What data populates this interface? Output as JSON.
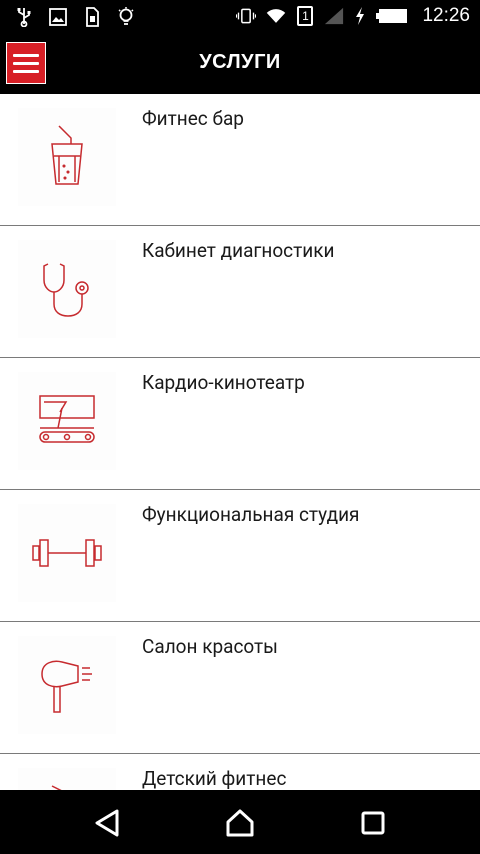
{
  "status_bar": {
    "time": "12:26",
    "sim_badge": "1",
    "icons": [
      "usb-icon",
      "image-icon",
      "sim-icon",
      "lightbulb-icon",
      "vibrate-icon",
      "wifi-icon",
      "signal-icon",
      "charging-icon",
      "battery-icon"
    ]
  },
  "app_bar": {
    "title": "УСЛУГИ",
    "menu_icon": "hamburger-menu-icon",
    "accent_color": "#d71f26"
  },
  "services": [
    {
      "label": "Фитнес бар",
      "icon": "drink-glass-icon"
    },
    {
      "label": "Кабинет диагностики",
      "icon": "stethoscope-icon"
    },
    {
      "label": "Кардио-кинотеатр",
      "icon": "treadmill-screen-icon"
    },
    {
      "label": "Функциональная студия",
      "icon": "dumbbell-icon"
    },
    {
      "label": "Салон красоты",
      "icon": "hair-dryer-icon"
    },
    {
      "label": "Детский фитнес",
      "icon": "kids-fitness-icon"
    }
  ],
  "nav_bar": {
    "icons": [
      "back-icon",
      "home-icon",
      "recents-icon"
    ]
  },
  "colors": {
    "icon_red": "#c62b2f",
    "divider": "#7a7a7a"
  }
}
